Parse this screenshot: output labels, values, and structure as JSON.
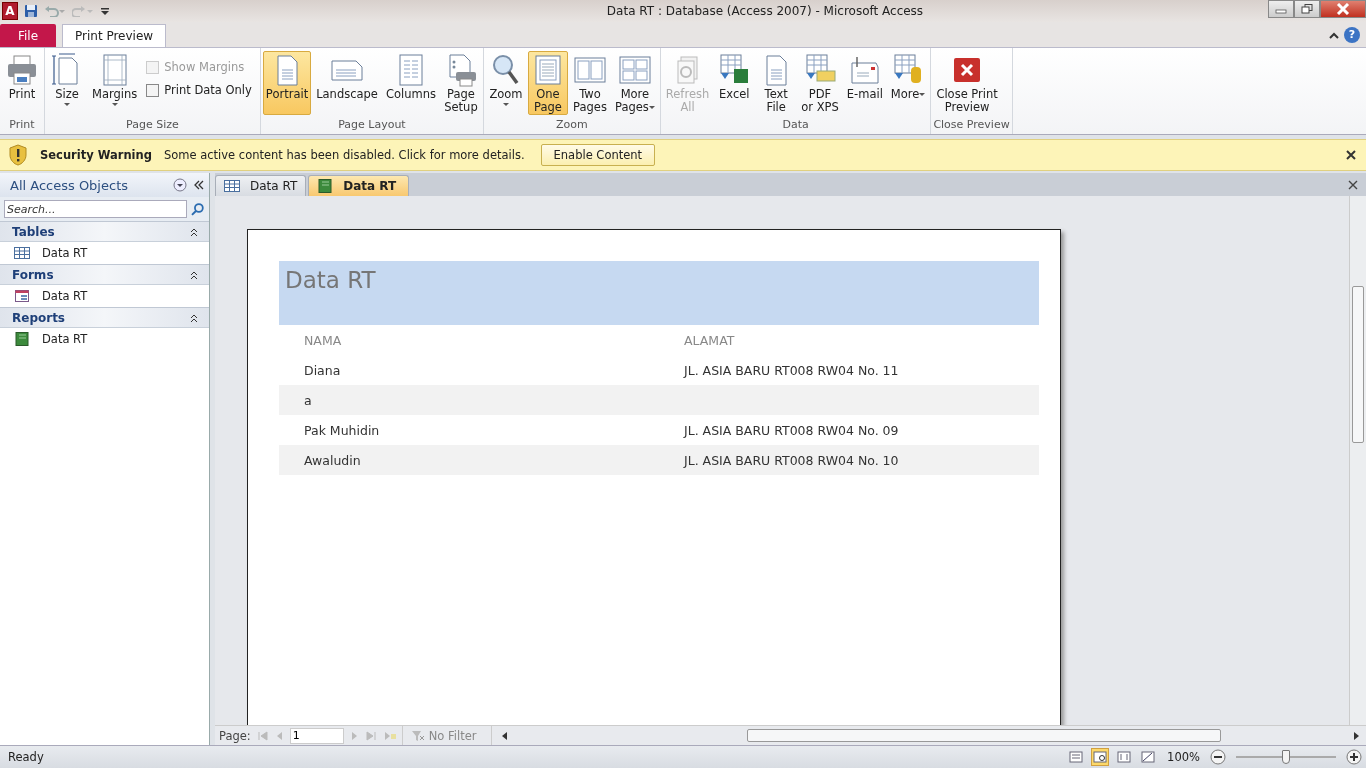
{
  "window": {
    "app_logo": "A",
    "title": "Data RT : Database (Access 2007)  -  Microsoft Access"
  },
  "ribbon_tabs": [
    {
      "label": "File",
      "kind": "file",
      "selected": false
    },
    {
      "label": "Print Preview",
      "kind": "tab",
      "selected": true
    }
  ],
  "help": "?",
  "ribbon_groups": [
    {
      "name": "Print",
      "buttons": [
        {
          "label": "Print",
          "dropdown": false,
          "selected": false,
          "disabled": false
        }
      ]
    },
    {
      "name": "Page Size",
      "buttons": [
        {
          "label": "Size",
          "dropdown": true,
          "selected": false,
          "disabled": false
        },
        {
          "label": "Margins",
          "dropdown": true,
          "selected": false,
          "disabled": false
        }
      ],
      "checkboxes": [
        {
          "label": "Show Margins",
          "checked": false,
          "disabled": true
        },
        {
          "label": "Print Data Only",
          "checked": false,
          "disabled": false
        }
      ]
    },
    {
      "name": "Page Layout",
      "buttons": [
        {
          "label": "Portrait",
          "dropdown": false,
          "selected": true,
          "disabled": false
        },
        {
          "label": "Landscape",
          "dropdown": false,
          "selected": false,
          "disabled": false
        },
        {
          "label": "Columns",
          "dropdown": false,
          "selected": false,
          "disabled": false
        },
        {
          "label": "Page\nSetup",
          "dropdown": false,
          "selected": false,
          "disabled": false
        }
      ]
    },
    {
      "name": "Zoom",
      "buttons": [
        {
          "label": "Zoom",
          "dropdown": true,
          "selected": false,
          "disabled": false
        },
        {
          "label": "One\nPage",
          "dropdown": false,
          "selected": true,
          "disabled": false
        },
        {
          "label": "Two\nPages",
          "dropdown": false,
          "selected": false,
          "disabled": false
        },
        {
          "label": "More\nPages",
          "dropdown": true,
          "selected": false,
          "disabled": false
        }
      ]
    },
    {
      "name": "Data",
      "buttons": [
        {
          "label": "Refresh\nAll",
          "dropdown": false,
          "selected": false,
          "disabled": true
        },
        {
          "label": "Excel",
          "dropdown": false,
          "selected": false,
          "disabled": false
        },
        {
          "label": "Text\nFile",
          "dropdown": false,
          "selected": false,
          "disabled": false
        },
        {
          "label": "PDF\nor XPS",
          "dropdown": false,
          "selected": false,
          "disabled": false
        },
        {
          "label": "E-mail",
          "dropdown": false,
          "selected": false,
          "disabled": false
        },
        {
          "label": "More",
          "dropdown": true,
          "selected": false,
          "disabled": false
        }
      ]
    },
    {
      "name": "Close Preview",
      "buttons": [
        {
          "label": "Close Print\nPreview",
          "dropdown": false,
          "selected": false,
          "disabled": false
        }
      ]
    }
  ],
  "message_bar": {
    "title": "Security Warning",
    "text": "Some active content has been disabled. Click for more details.",
    "button": "Enable Content"
  },
  "nav_pane": {
    "title": "All Access Objects",
    "search_placeholder": "Search...",
    "groups": [
      {
        "name": "Tables",
        "items": [
          {
            "label": "Data RT",
            "kind": "table"
          }
        ]
      },
      {
        "name": "Forms",
        "items": [
          {
            "label": "Data RT",
            "kind": "form"
          }
        ]
      },
      {
        "name": "Reports",
        "items": [
          {
            "label": "Data RT",
            "kind": "report"
          }
        ]
      }
    ]
  },
  "doc_tabs": [
    {
      "label": "Data RT",
      "kind": "table",
      "selected": false
    },
    {
      "label": "Data RT",
      "kind": "report",
      "selected": true
    }
  ],
  "report": {
    "title": "Data RT",
    "columns": [
      "NAMA",
      "ALAMAT"
    ],
    "rows": [
      [
        "Diana",
        "JL. ASIA BARU RT008 RW04 No. 11"
      ],
      [
        "a",
        ""
      ],
      [
        "Pak Muhidin",
        "JL. ASIA BARU RT008 RW04 No. 09"
      ],
      [
        "Awaludin",
        "JL. ASIA BARU RT008 RW04 No. 10"
      ]
    ]
  },
  "record_nav": {
    "label": "Page:",
    "value": "1",
    "filter": "No Filter"
  },
  "status_bar": {
    "text": "Ready",
    "views": [
      {
        "selected": false
      },
      {
        "selected": true
      },
      {
        "selected": false
      },
      {
        "selected": false
      }
    ],
    "zoom": "100%",
    "level": 0.5
  }
}
